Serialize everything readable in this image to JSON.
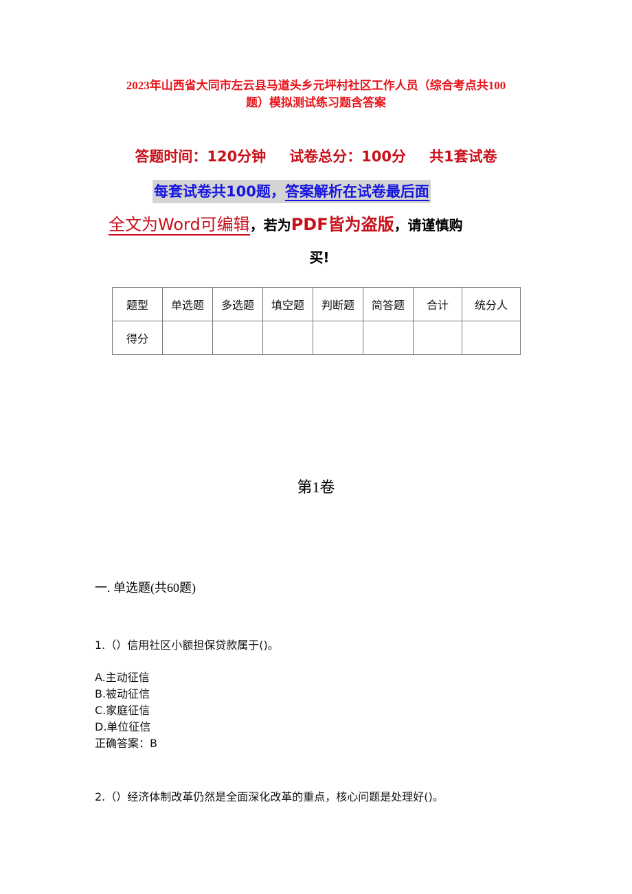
{
  "document": {
    "title_line1": "2023年山西省大同市左云县马道头乡元坪村社区工作人员（综合考点共100",
    "title_line2": "题）模拟测试练习题含答案",
    "exam_info": {
      "time": "答题时间：120分钟",
      "total_score": "试卷总分：100分",
      "sets": "共1套试卷"
    },
    "notice": {
      "part1": "每套试卷共100题，",
      "part2": "答案解析在试卷最后面"
    },
    "warning": {
      "part1": "全文为Word可编辑",
      "part2": "，若为",
      "part3": "PDF皆为盗版",
      "part4": "，请谨慎购",
      "part5": "买!"
    },
    "score_table": {
      "header": [
        "题型",
        "单选题",
        "多选题",
        "填空题",
        "判断题",
        "简答题",
        "合计",
        "统分人"
      ],
      "row": [
        "得分",
        "",
        "",
        "",
        "",
        "",
        "",
        ""
      ]
    },
    "volume_title": "第1卷",
    "section_title": "一. 单选题(共60题)",
    "questions": [
      {
        "text": "1.（）信用社区小额担保贷款属于()。",
        "options": [
          "A.主动征信",
          "B.被动征信",
          "C.家庭征信",
          "D.单位征信"
        ],
        "answer": "正确答案：B"
      },
      {
        "text": "2.（）经济体制改革仍然是全面深化改革的重点，核心问题是处理好()。"
      }
    ]
  }
}
